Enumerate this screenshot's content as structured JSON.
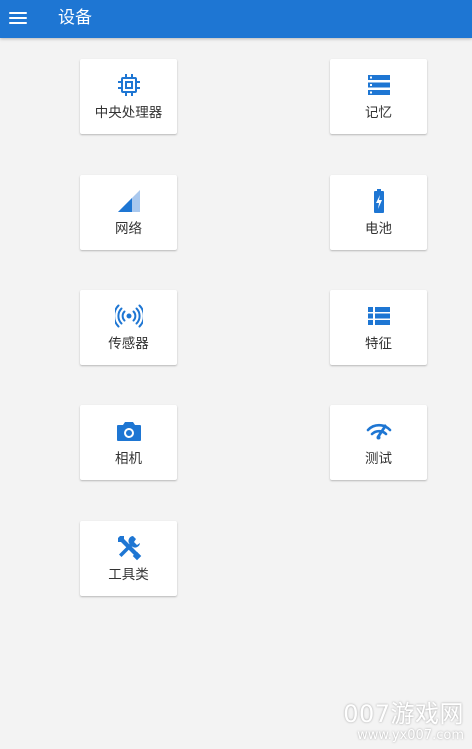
{
  "app": {
    "title": "设备"
  },
  "colors": {
    "accent": "#1e76d3",
    "background": "#f3f3f3",
    "tile": "#ffffff"
  },
  "tiles": [
    {
      "label": "中央处理器",
      "icon": "cpu-icon"
    },
    {
      "label": "记忆",
      "icon": "memory-icon"
    },
    {
      "label": "网络",
      "icon": "signal-icon"
    },
    {
      "label": "电池",
      "icon": "battery-icon"
    },
    {
      "label": "传感器",
      "icon": "sensor-icon"
    },
    {
      "label": "特征",
      "icon": "list-icon"
    },
    {
      "label": "相机",
      "icon": "camera-icon"
    },
    {
      "label": "测试",
      "icon": "test-wifi-icon"
    },
    {
      "label": "工具类",
      "icon": "tools-icon"
    }
  ],
  "watermark": {
    "line1": "007游戏网",
    "line2": "www.yx007.com"
  }
}
